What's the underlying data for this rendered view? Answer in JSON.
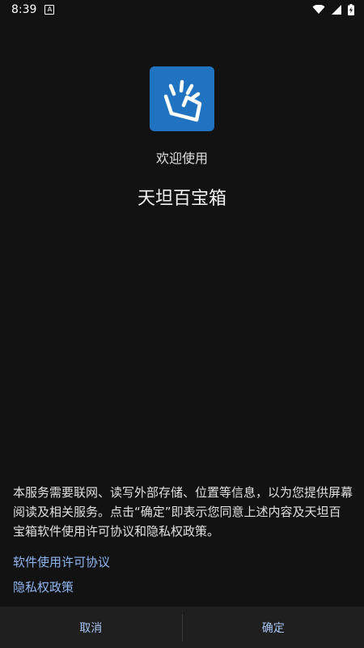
{
  "status_bar": {
    "time": "8:39",
    "notification_icon": "a-letter-icon",
    "icons": [
      "wifi-icon",
      "signal-icon",
      "battery-charging-icon"
    ]
  },
  "app": {
    "logo_icon": "app-logo-icon",
    "logo_color": "#1f73c0",
    "welcome": "欢迎使用",
    "name": "天坦百宝箱"
  },
  "notice": {
    "text": "本服务需要联网、读写外部存储、位置等信息，以为您提供屏幕阅读及相关服务。点击“确定”即表示您同意上述内容及天坦百宝箱软件使用许可协议和隐私权政策。"
  },
  "links": {
    "license": "软件使用许可协议",
    "privacy": "隐私权政策",
    "color": "#8fb6f3"
  },
  "buttons": {
    "cancel": "取消",
    "confirm": "确定"
  }
}
